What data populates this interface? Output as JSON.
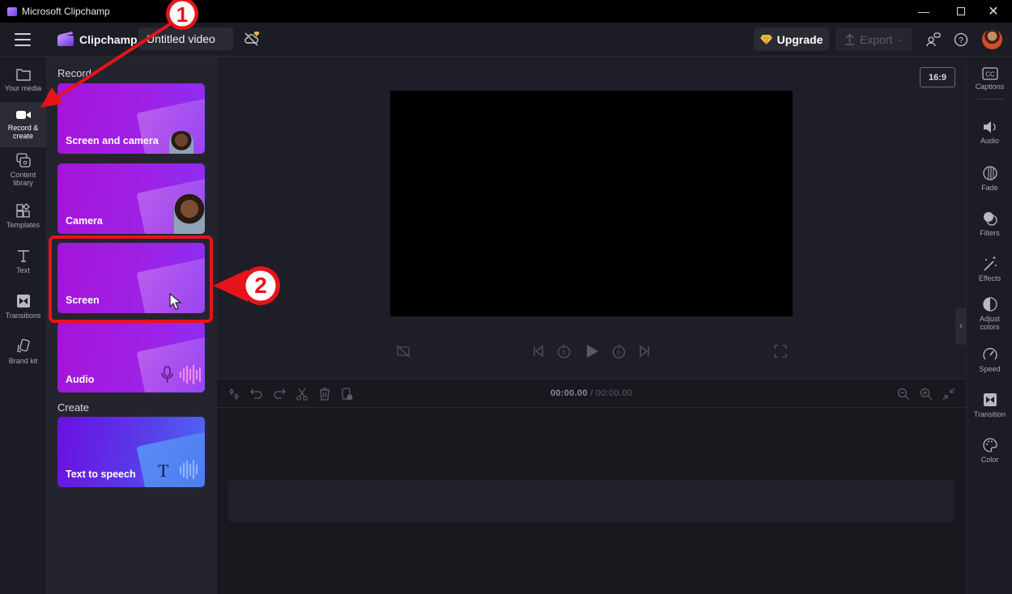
{
  "window": {
    "title": "Microsoft Clipchamp",
    "controls": [
      "minimize",
      "maximize",
      "close"
    ]
  },
  "header": {
    "brand": "Clipchamp",
    "project_title": "Untitled video",
    "upgrade_label": "Upgrade",
    "export_label": "Export"
  },
  "left_nav": {
    "items": [
      {
        "label": "Your media",
        "icon": "folder-icon"
      },
      {
        "label": "Record & create",
        "icon": "video-camera-icon",
        "active": true
      },
      {
        "label": "Content library",
        "icon": "content-library-icon"
      },
      {
        "label": "Templates",
        "icon": "templates-icon"
      },
      {
        "label": "Text",
        "icon": "text-icon"
      },
      {
        "label": "Transitions",
        "icon": "transitions-icon"
      },
      {
        "label": "Brand kit",
        "icon": "brand-kit-icon"
      }
    ]
  },
  "panel": {
    "record_heading": "Record",
    "create_heading": "Create",
    "record_cards": [
      {
        "label": "Screen and camera"
      },
      {
        "label": "Camera"
      },
      {
        "label": "Screen"
      },
      {
        "label": "Audio"
      }
    ],
    "create_cards": [
      {
        "label": "Text to speech"
      }
    ]
  },
  "stage": {
    "aspect_ratio": "16:9"
  },
  "timeline": {
    "current_time": "00:00.00",
    "separator": " / ",
    "total_time": "00:00.00"
  },
  "right_nav": {
    "items": [
      {
        "label": "Captions",
        "icon": "captions-icon"
      },
      {
        "label": "Audio",
        "icon": "speaker-icon"
      },
      {
        "label": "Fade",
        "icon": "fade-icon"
      },
      {
        "label": "Filters",
        "icon": "filters-icon"
      },
      {
        "label": "Effects",
        "icon": "effects-wand-icon"
      },
      {
        "label": "Adjust colors",
        "icon": "adjust-colors-icon"
      },
      {
        "label": "Speed",
        "icon": "speedometer-icon"
      },
      {
        "label": "Transition",
        "icon": "transition-icon"
      },
      {
        "label": "Color",
        "icon": "palette-icon"
      }
    ]
  },
  "annotations": {
    "step1": "1",
    "step2": "2",
    "color": "#e6141a"
  },
  "colors": {
    "accent_purple": "#9d22e6",
    "background": "#1e1e28",
    "panel": "#24242e"
  }
}
